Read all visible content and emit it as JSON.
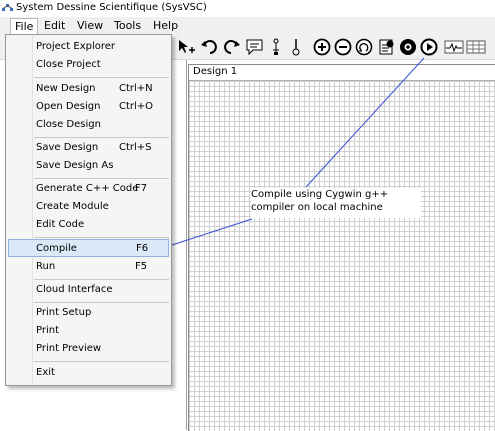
{
  "window": {
    "title": "System Dessine Scientifique (SysVSC)"
  },
  "menubar": {
    "items": [
      {
        "label": "File",
        "active": true
      },
      {
        "label": "Edit"
      },
      {
        "label": "View"
      },
      {
        "label": "Tools"
      },
      {
        "label": "Help"
      }
    ]
  },
  "toolbar": {
    "icons": [
      "plus-cursor-icon",
      "undo-icon",
      "redo-icon",
      "comment-icon",
      "text-icon",
      "probe-icon",
      "zoom-in-icon",
      "zoom-out-icon",
      "zoom-reset-icon",
      "compile-icon",
      "build-icon",
      "run-icon",
      "waveform-icon",
      "table-icon"
    ]
  },
  "design": {
    "tab_label": "Design 1"
  },
  "file_menu": {
    "items": [
      {
        "label": "Project Explorer",
        "shortcut": ""
      },
      {
        "label": "Close Project",
        "shortcut": ""
      },
      {
        "label": "New Design",
        "shortcut": "Ctrl+N"
      },
      {
        "label": "Open Design",
        "shortcut": "Ctrl+O"
      },
      {
        "label": "Close Design",
        "shortcut": ""
      },
      {
        "label": "Save Design",
        "shortcut": "Ctrl+S"
      },
      {
        "label": "Save Design  As",
        "shortcut": ""
      },
      {
        "label": "Generate C++ Code",
        "shortcut": "F7"
      },
      {
        "label": "Create Module",
        "shortcut": ""
      },
      {
        "label": "Edit Code",
        "shortcut": ""
      },
      {
        "label": "Compile",
        "shortcut": "F6",
        "highlighted": true
      },
      {
        "label": "Run",
        "shortcut": "F5"
      },
      {
        "label": "Cloud Interface",
        "shortcut": ""
      },
      {
        "label": "Print Setup",
        "shortcut": ""
      },
      {
        "label": "Print",
        "shortcut": ""
      },
      {
        "label": "Print Preview",
        "shortcut": ""
      },
      {
        "label": "Exit",
        "shortcut": ""
      }
    ]
  },
  "annotation": {
    "line1": "Compile using Cygwin g++",
    "line2": "compiler on local machine"
  },
  "colors": {
    "highlight_fill": "#dbe8f7",
    "highlight_border": "#8db2e3",
    "leader_line": "#3a4fd6"
  }
}
